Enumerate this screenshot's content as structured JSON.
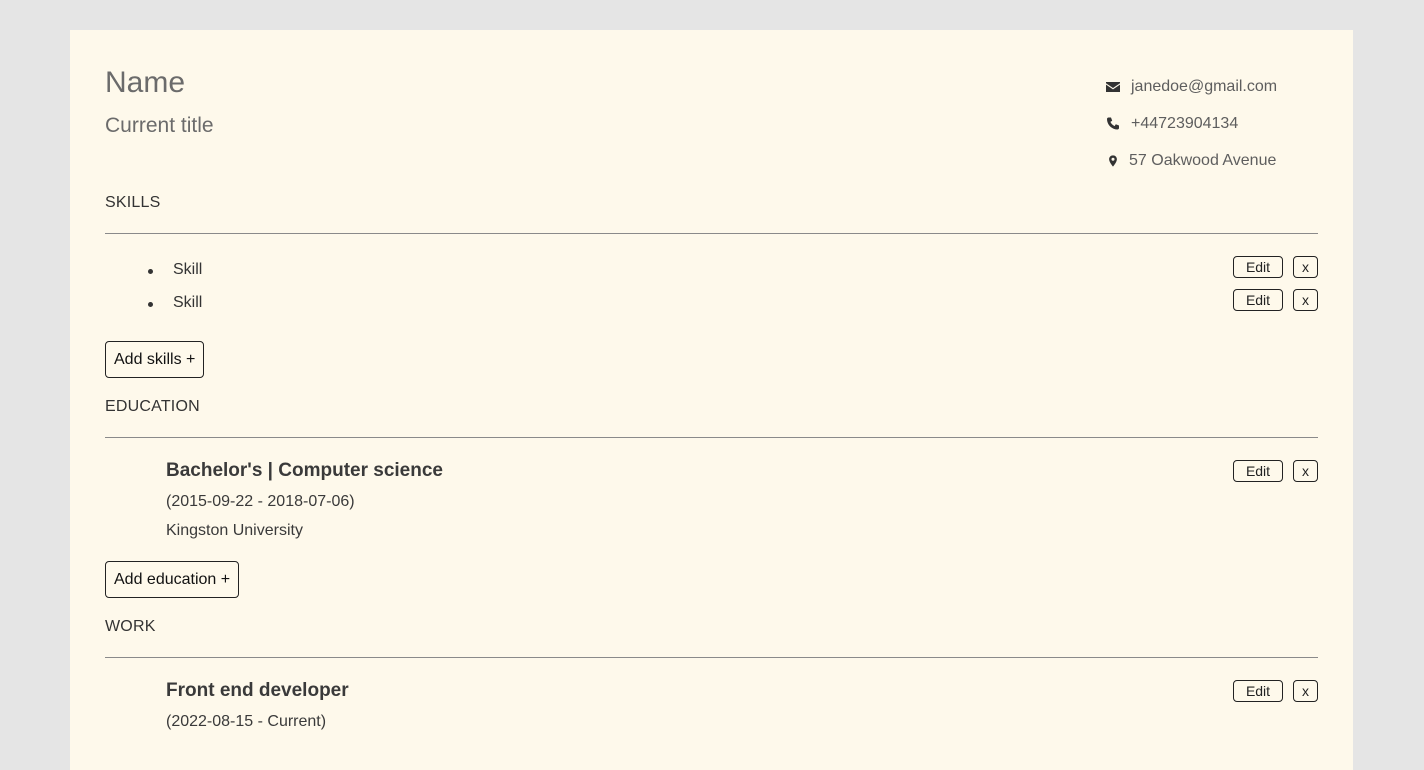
{
  "profile": {
    "name": "Name",
    "title": "Current title"
  },
  "contact": {
    "email": "janedoe@gmail.com",
    "phone": "+44723904134",
    "address": "57 Oakwood Avenue",
    "icons": [
      "envelope-icon",
      "phone-icon",
      "location-pin-icon"
    ]
  },
  "sections": {
    "skills": "SKILLS",
    "education": "EDUCATION",
    "work": "WORK"
  },
  "skills": {
    "items": [
      {
        "label": "Skill"
      },
      {
        "label": "Skill"
      }
    ],
    "add_label": "Add skills +"
  },
  "education": {
    "items": [
      {
        "title": "Bachelor's | Computer science",
        "dates": "(2015-09-22 - 2018-07-06)",
        "institution": "Kingston University"
      }
    ],
    "add_label": "Add education +"
  },
  "work": {
    "items": [
      {
        "title": "Front end developer",
        "dates": "(2022-08-15 - Current)"
      }
    ]
  },
  "buttons": {
    "edit": "Edit",
    "remove": "x"
  },
  "colors": {
    "page_background": "#fef9eb",
    "outer_background": "#e5e5e5"
  }
}
